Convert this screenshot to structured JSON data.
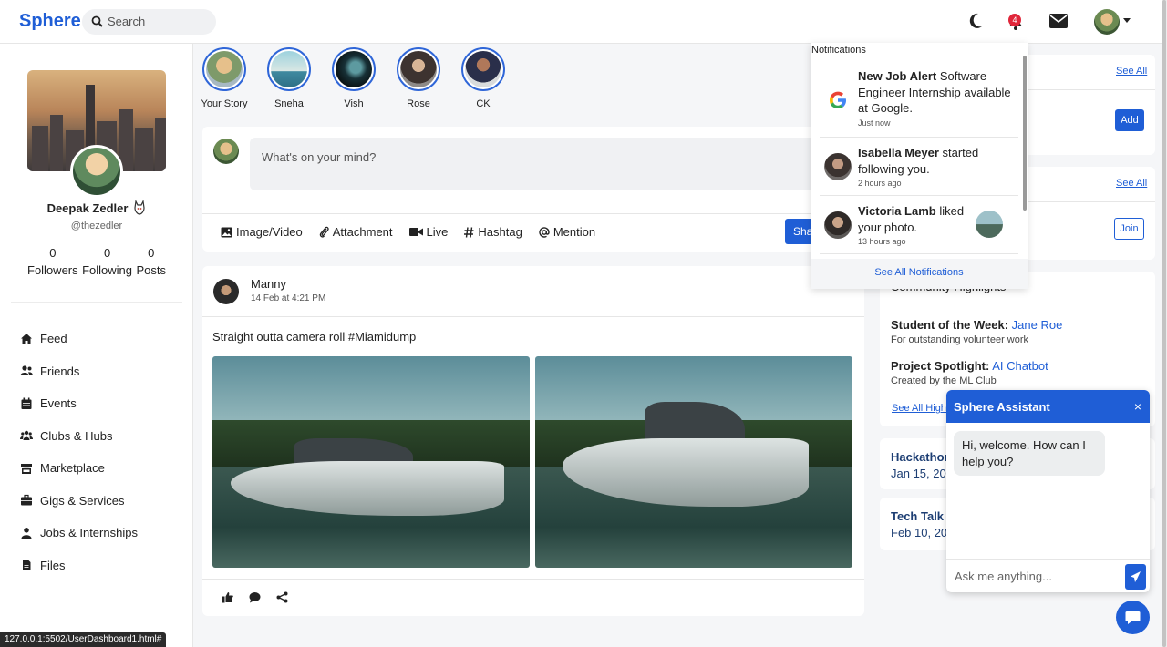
{
  "header": {
    "logo": "Sphere",
    "search_placeholder": "Search",
    "notification_count": "4"
  },
  "profile": {
    "name": "Deepak Zedler",
    "handle": "@thezedler",
    "stats": [
      {
        "value": "0",
        "label": "Followers"
      },
      {
        "value": "0",
        "label": "Following"
      },
      {
        "value": "0",
        "label": "Posts"
      }
    ]
  },
  "nav": [
    {
      "label": "Feed",
      "icon": "home-icon"
    },
    {
      "label": "Friends",
      "icon": "friends-icon"
    },
    {
      "label": "Events",
      "icon": "calendar-icon"
    },
    {
      "label": "Clubs & Hubs",
      "icon": "group-icon"
    },
    {
      "label": "Marketplace",
      "icon": "store-icon"
    },
    {
      "label": "Gigs & Services",
      "icon": "briefcase-icon"
    },
    {
      "label": "Jobs & Internships",
      "icon": "user-tie-icon"
    },
    {
      "label": "Files",
      "icon": "file-icon"
    }
  ],
  "stories": [
    "Your Story",
    "Sneha",
    "Vish",
    "Rose",
    "CK"
  ],
  "composer": {
    "placeholder": "What's on your mind?",
    "actions": [
      "Image/Video",
      "Attachment",
      "Live",
      "Hashtag",
      "Mention"
    ],
    "share_label": "Share"
  },
  "post": {
    "author": "Manny",
    "time": "14 Feb at 4:21 PM",
    "text": "Straight outta camera roll #Miamidump"
  },
  "right": {
    "see_all": "See All",
    "add_label": "Add",
    "join_label": "Join",
    "highlights_title": "Community Highlights",
    "student_label": "Student of the Week:",
    "student_name": "Jane Roe",
    "student_sub": "For outstanding volunteer work",
    "project_label": "Project Spotlight:",
    "project_name": "AI Chatbot",
    "project_sub": "Created by the ML Club",
    "see_all_highlights": "See All Highlights",
    "events": [
      {
        "title": "Hackathon",
        "date": "Jan 15, 2025"
      },
      {
        "title": "Tech Talk",
        "date": "Feb 10, 2025"
      }
    ]
  },
  "notifications": {
    "title": "Notifications",
    "items": [
      {
        "bold": "New Job Alert",
        "rest": " Software Engineer Internship available at Google.",
        "time": "Just now"
      },
      {
        "bold": "Isabella Meyer",
        "rest": " started following you.",
        "time": "2 hours ago"
      },
      {
        "bold": "Victoria Lamb",
        "rest": " liked your photo.",
        "time": "13 hours ago"
      }
    ],
    "footer": "See All Notifications"
  },
  "chat": {
    "title": "Sphere Assistant",
    "close": "×",
    "message": "Hi, welcome. How can I help you?",
    "placeholder": "Ask me anything..."
  },
  "status_url": "127.0.0.1:5502/UserDashboard1.html#"
}
